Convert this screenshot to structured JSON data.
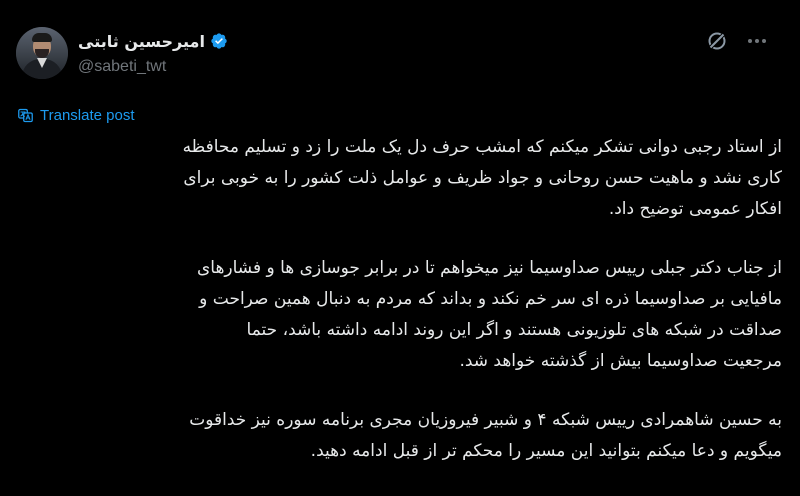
{
  "author": {
    "display_name": "امیرحسین ثابتی",
    "handle": "@sabeti_twt",
    "verified": true
  },
  "actions": {
    "grok_icon": "grok-icon",
    "more_icon": "more-dots-icon"
  },
  "translate": {
    "label": "Translate post"
  },
  "post": {
    "paragraphs": [
      {
        "lines": [
          "از استاد رجبی دوانی تشکر میکنم که امشب حرف دل یک ملت را زد و تسلیم محافظه",
          "کاری نشد و ماهیت حسن روحانی و جواد ظریف و عوامل ذلت کشور را به خوبی برای",
          "افکار عمومی توضیح داد."
        ]
      },
      {
        "lines": [
          "از جناب دکتر جبلی رییس صداوسیما نیز میخواهم تا در برابر جوسازی ها و فشارهای",
          "مافیایی بر صداوسیما ذره ای سر خم نکند و بداند که مردم به دنبال همین صراحت و",
          "صداقت در شبکه های تلوزیونی هستند و اگر این روند ادامه داشته باشد، حتما",
          "مرجعیت صداوسیما بیش از گذشته خواهد شد."
        ]
      },
      {
        "lines": [
          "به حسین شاهمرادی رییس شبکه ۴ و شبیر فیروزیان مجری برنامه سوره نیز خداقوت",
          "میگویم و دعا میکنم بتوانید این مسیر را محکم تر از قبل ادامه دهید."
        ]
      }
    ]
  },
  "colors": {
    "background": "#000000",
    "text": "#e7e9ea",
    "secondary": "#71767b",
    "accent": "#1d9bf0"
  }
}
